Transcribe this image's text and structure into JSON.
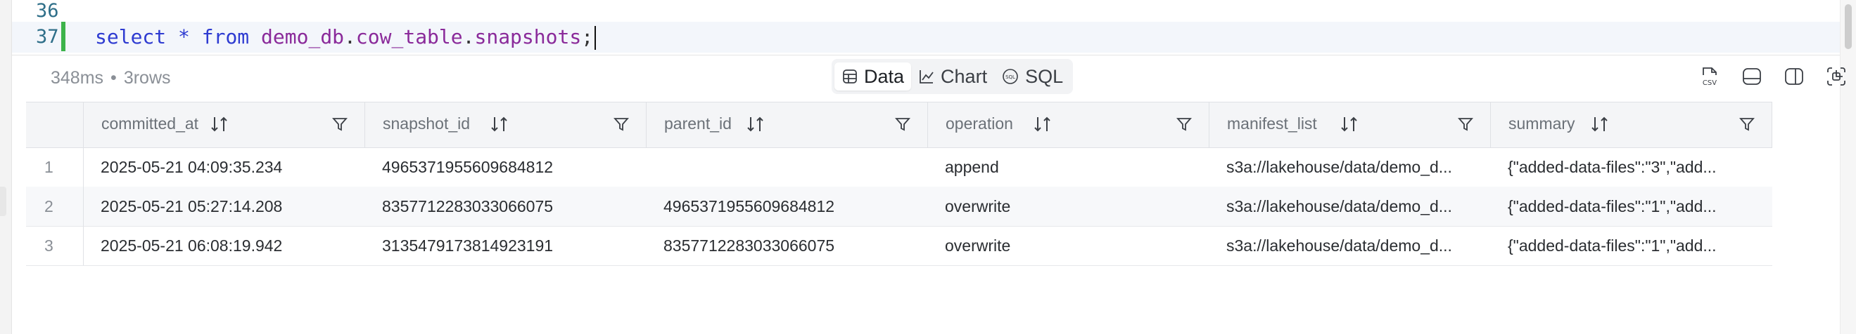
{
  "editor": {
    "lines": [
      {
        "number": "36",
        "text": ""
      },
      {
        "number": "37",
        "tokens": [
          {
            "text": "select",
            "kind": "keyword"
          },
          {
            "text": " ",
            "kind": "space"
          },
          {
            "text": "*",
            "kind": "operator"
          },
          {
            "text": " ",
            "kind": "space"
          },
          {
            "text": "from",
            "kind": "keyword"
          },
          {
            "text": " ",
            "kind": "space"
          },
          {
            "text": "demo_db",
            "kind": "identifier"
          },
          {
            "text": ".",
            "kind": "punct"
          },
          {
            "text": "cow_table",
            "kind": "identifier"
          },
          {
            "text": ".",
            "kind": "punct"
          },
          {
            "text": "snapshots",
            "kind": "identifier"
          },
          {
            "text": ";",
            "kind": "punct"
          }
        ]
      }
    ]
  },
  "result": {
    "time": "348ms",
    "separator": "•",
    "rows_label": "3rows"
  },
  "view_tabs": [
    {
      "label": "Data",
      "icon": "table-icon",
      "active": true
    },
    {
      "label": "Chart",
      "icon": "line-chart-icon",
      "active": false
    },
    {
      "label": "SQL",
      "icon": "sql-icon",
      "active": false
    }
  ],
  "toolbar_icons": [
    "csv-export-icon",
    "bottom-panel-icon",
    "side-panel-icon",
    "expand-icon"
  ],
  "table": {
    "columns": [
      "committed_at",
      "snapshot_id",
      "parent_id",
      "operation",
      "manifest_list",
      "summary"
    ],
    "rows": [
      {
        "n": "1",
        "cells": [
          "2025-05-21 04:09:35.234",
          "4965371955609684812",
          "",
          "append",
          "s3a://lakehouse/data/demo_d...",
          "{\"added-data-files\":\"3\",\"add..."
        ]
      },
      {
        "n": "2",
        "cells": [
          "2025-05-21 05:27:14.208",
          "8357712283033066075",
          "4965371955609684812",
          "overwrite",
          "s3a://lakehouse/data/demo_d...",
          "{\"added-data-files\":\"1\",\"add..."
        ]
      },
      {
        "n": "3",
        "cells": [
          "2025-05-21 06:08:19.942",
          "3135479173814923191",
          "8357712283033066075",
          "overwrite",
          "s3a://lakehouse/data/demo_d...",
          "{\"added-data-files\":\"1\",\"add..."
        ]
      }
    ]
  },
  "colors": {
    "keyword": "#2e3bd1",
    "identifier": "#8a2a9a",
    "line_number": "#2f6f89",
    "change_bar": "#3db34a"
  }
}
